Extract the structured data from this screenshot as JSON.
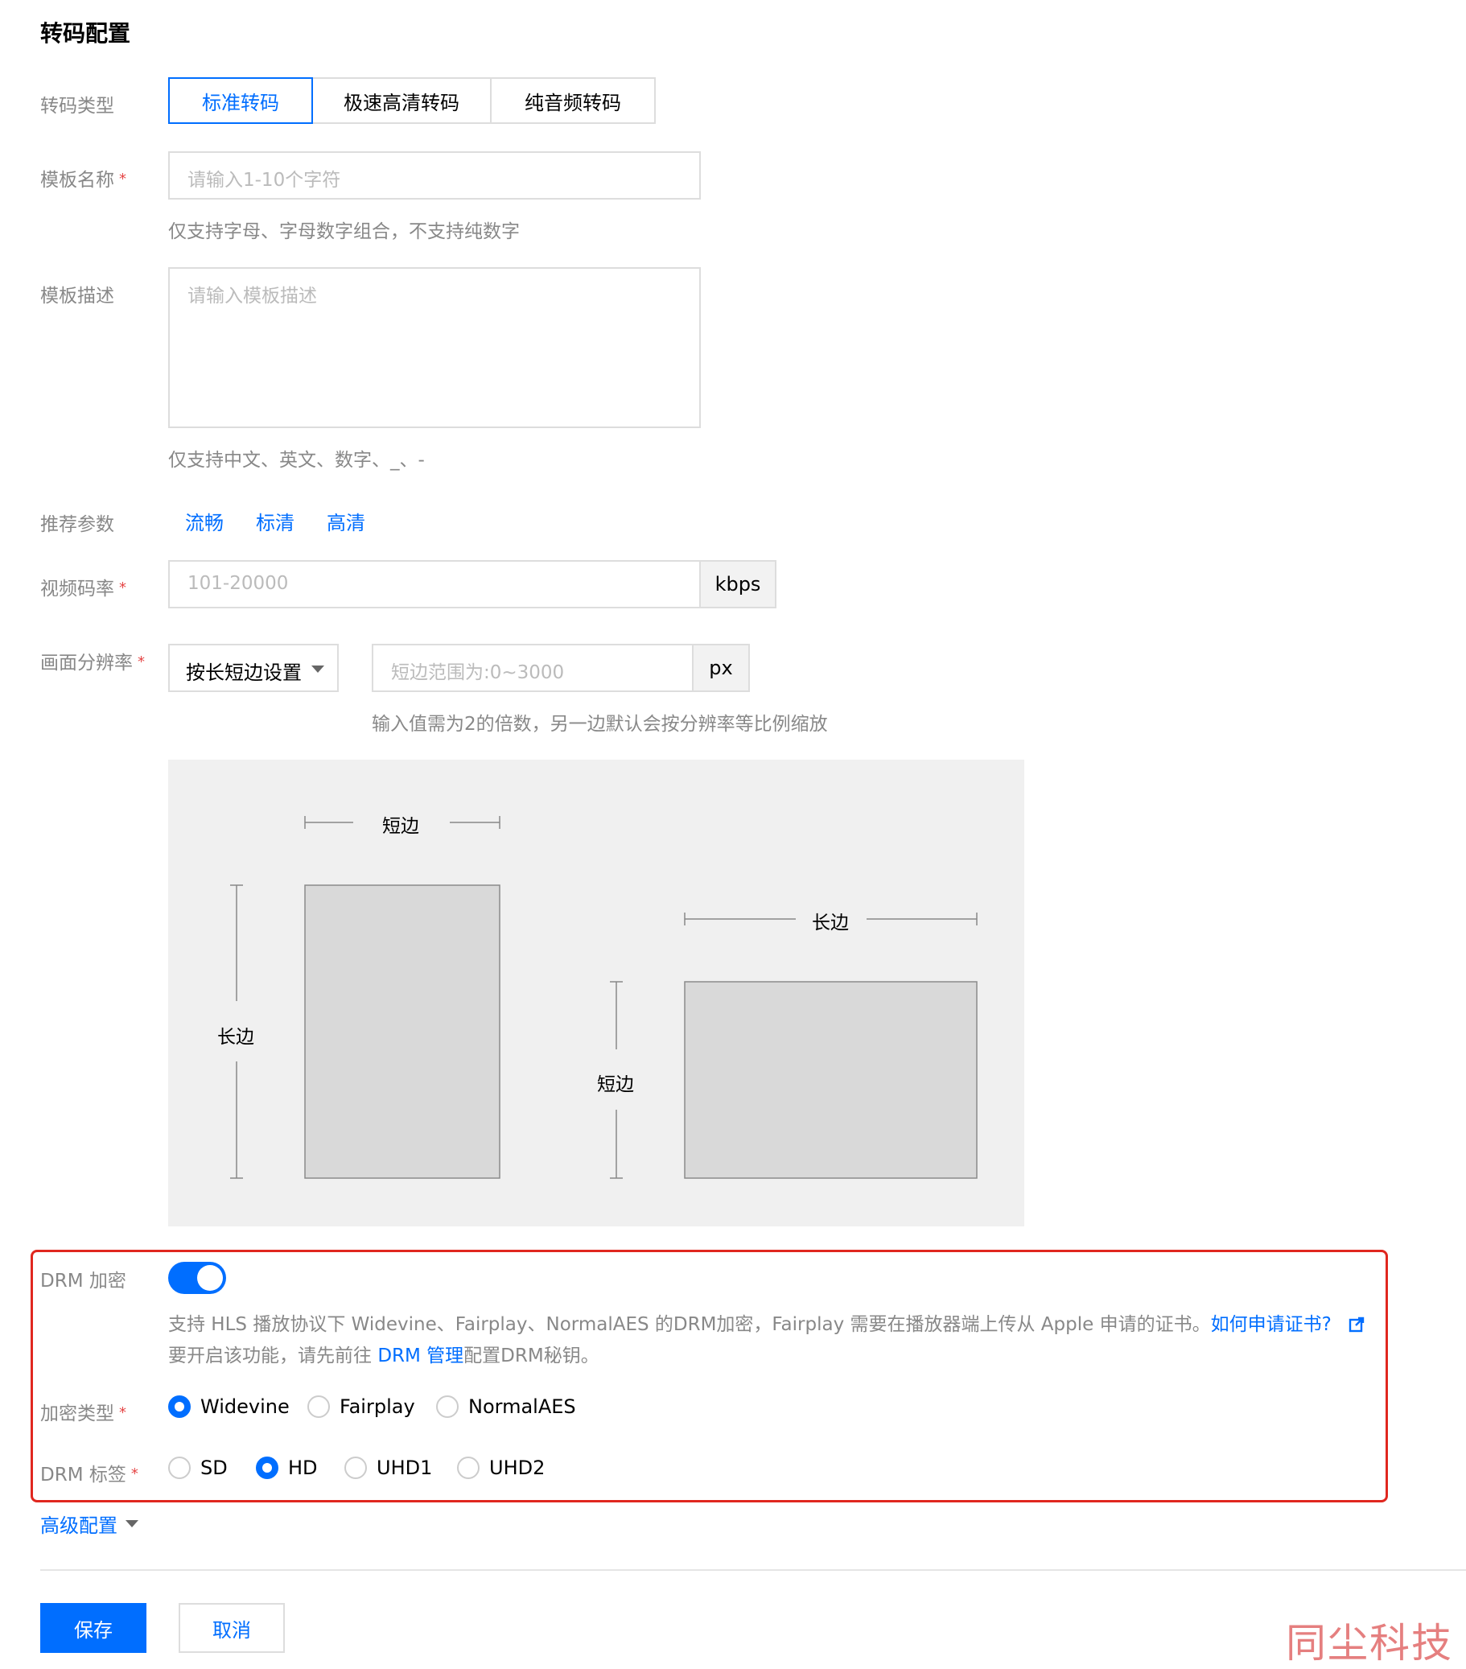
{
  "section_title": "转码配置",
  "transcode_type": {
    "label": "转码类型",
    "options": [
      "标准转码",
      "极速高清转码",
      "纯音频转码"
    ],
    "selected": "标准转码"
  },
  "template_name": {
    "label": "模板名称",
    "required_mark": "*",
    "placeholder": "请输入1-10个字符",
    "help": "仅支持字母、字母数字组合，不支持纯数字"
  },
  "template_desc": {
    "label": "模板描述",
    "placeholder": "请输入模板描述",
    "help": "仅支持中文、英文、数字、_、-"
  },
  "recommended": {
    "label": "推荐参数",
    "options": [
      "流畅",
      "标清",
      "高清"
    ]
  },
  "video_bitrate": {
    "label": "视频码率",
    "required_mark": "*",
    "placeholder": "101-20000",
    "unit": "kbps"
  },
  "resolution": {
    "label": "画面分辨率",
    "required_mark": "*",
    "mode_value": "按长短边设置",
    "placeholder": "短边范围为:0~3000",
    "unit": "px",
    "help": "输入值需为2的倍数，另一边默认会按分辨率等比例缩放"
  },
  "diagram": {
    "portrait_short_label": "短边",
    "portrait_long_label": "长边",
    "landscape_long_label": "长边",
    "landscape_short_label": "短边"
  },
  "drm": {
    "label": "DRM 加密",
    "enabled": true,
    "desc_part1": "支持 HLS 播放协议下 Widevine、Fairplay、NormalAES 的DRM加密，Fairplay 需要在播放器端上传从 Apple 申请的证书。",
    "cert_link": "如何申请证书?",
    "desc_part2": "要开启该功能，请先前往 ",
    "drm_manage_link": "DRM 管理",
    "desc_part3": "配置DRM秘钥。",
    "encrypt_type": {
      "label": "加密类型",
      "required_mark": "*",
      "options": [
        "Widevine",
        "Fairplay",
        "NormalAES"
      ],
      "selected": "Widevine"
    },
    "tag": {
      "label": "DRM 标签",
      "required_mark": "*",
      "options": [
        "SD",
        "HD",
        "UHD1",
        "UHD2"
      ],
      "selected": "HD"
    }
  },
  "advanced": {
    "label": "高级配置"
  },
  "buttons": {
    "save": "保存",
    "cancel": "取消"
  },
  "watermark": "同尘科技",
  "colors": {
    "primary": "#006eff",
    "required": "#e54545",
    "highlight_border": "#e0271f"
  }
}
